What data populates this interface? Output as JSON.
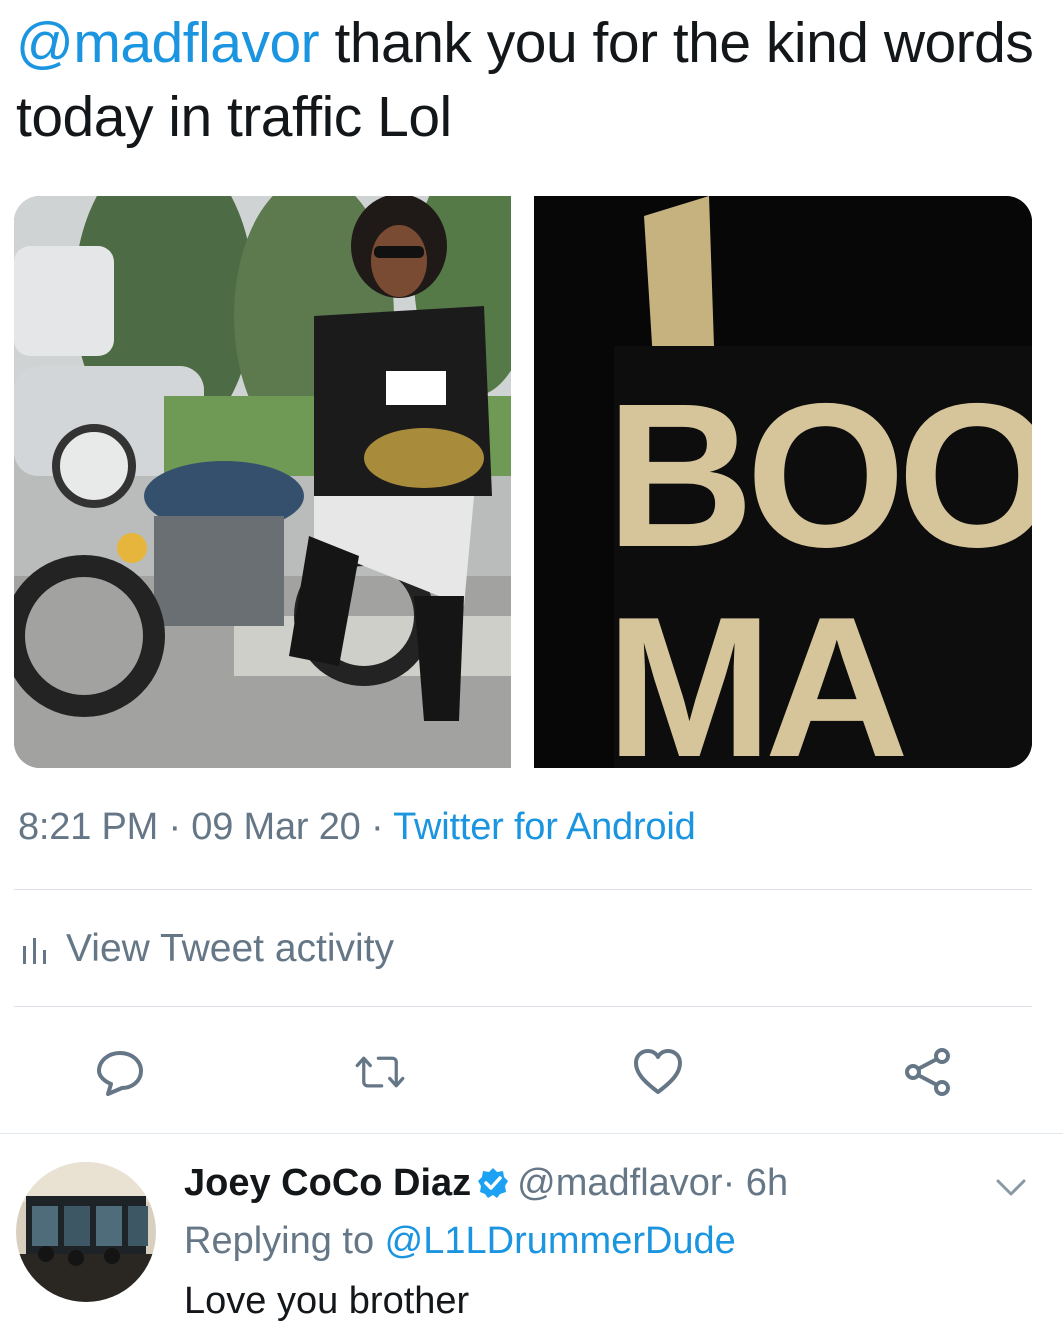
{
  "tweet": {
    "mention": "@madflavor",
    "text": " thank you for the kind words today in traffic Lol",
    "media_left_icon": "photo-man-motorcycle",
    "media_right_icon": "photo-booty-man-closeup",
    "media_right_text_line1": "BOO",
    "media_right_text_line2": "MA",
    "time": "8:21 PM",
    "date": "09 Mar 20",
    "separator": " · ",
    "source": "Twitter for Android"
  },
  "activity": {
    "icon": "bar-chart-icon",
    "label": "View Tweet activity"
  },
  "actions": [
    {
      "name": "reply",
      "icon": "speech-bubble-icon"
    },
    {
      "name": "retweet",
      "icon": "retweet-icon"
    },
    {
      "name": "like",
      "icon": "heart-icon"
    },
    {
      "name": "share",
      "icon": "share-icon"
    }
  ],
  "reply": {
    "display_name": "Joey CoCo Diaz",
    "handle": "@madflavor",
    "time": " · 6h",
    "replying_prefix": "Replying to ",
    "replying_to": "@L1LDrummerDude",
    "text": "Love you brother"
  },
  "colors": {
    "accent": "#1b95e0",
    "muted": "#657786",
    "text": "#14171a",
    "divider": "#e1e8ed"
  }
}
